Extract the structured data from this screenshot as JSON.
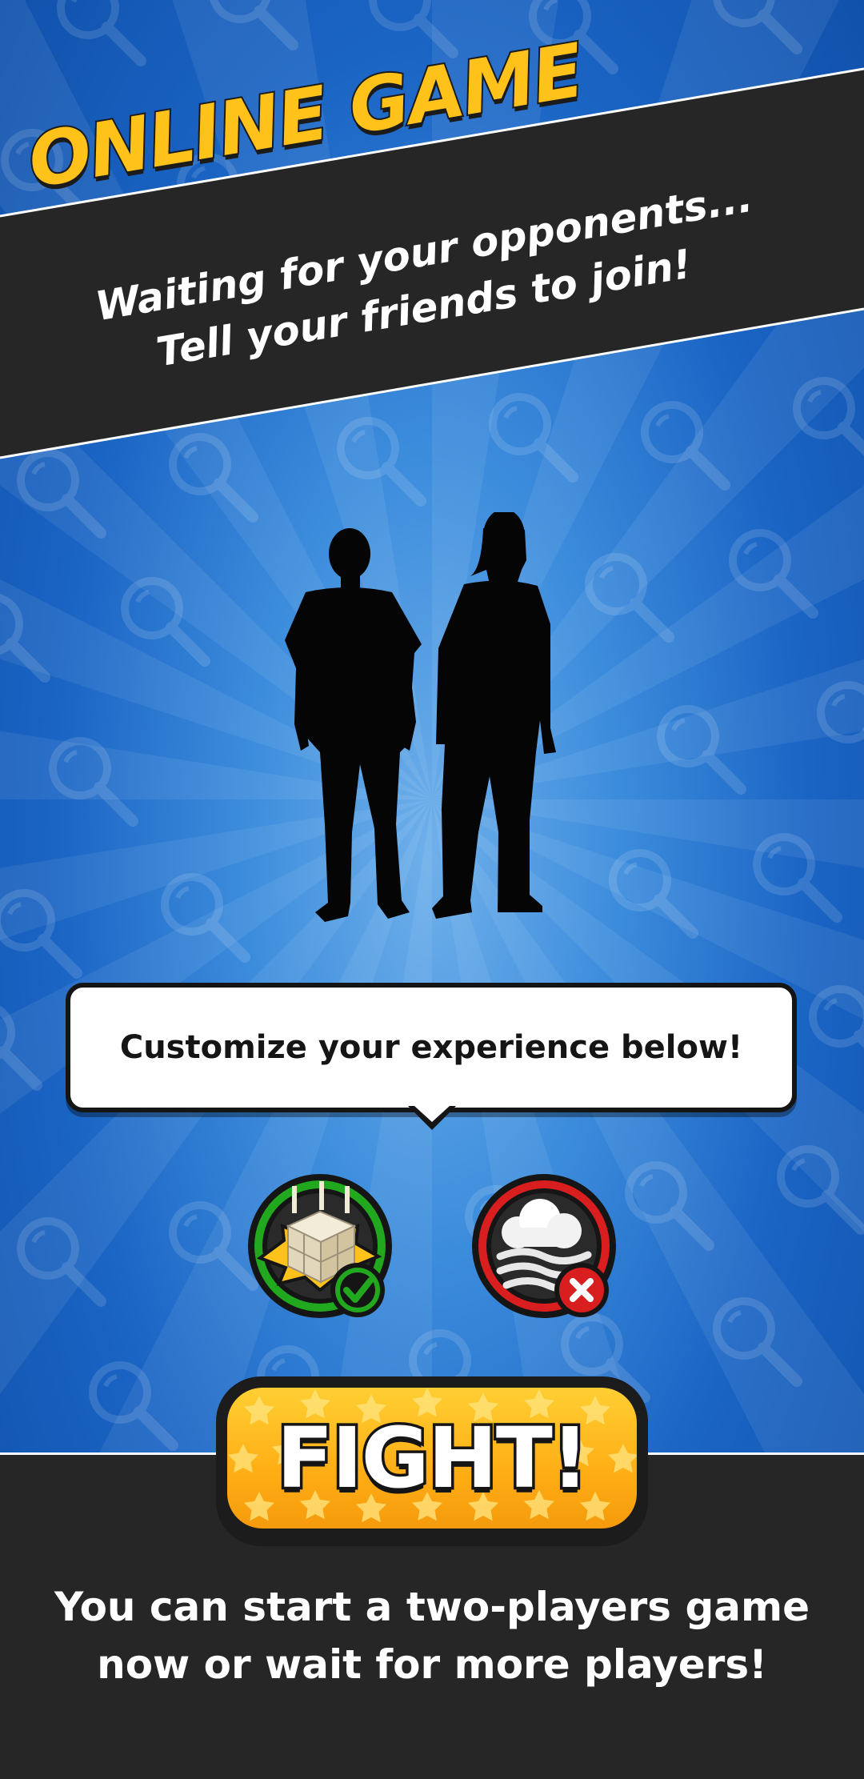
{
  "header": {
    "title": "ONLINE GAME",
    "subtitle_line1": "Waiting for your opponents...",
    "subtitle_line2": "Tell your friends to join!"
  },
  "bubble": {
    "text": "Customize your experience below!"
  },
  "options": [
    {
      "name": "crate-explosion-option",
      "icon": "crate-explosion-icon",
      "status": "enabled",
      "badge": "check-badge-icon",
      "ring_color": "#22a81e"
    },
    {
      "name": "cloud-wind-option",
      "icon": "cloud-wind-icon",
      "status": "disabled",
      "badge": "cross-badge-icon",
      "ring_color": "#d81e1e"
    }
  ],
  "fight_button": {
    "label": "FIGHT!"
  },
  "footer": {
    "line1": "You can start a two-players game",
    "line2": "now or wait for more players!"
  },
  "colors": {
    "accent": "#ffc21a",
    "banner": "#262626",
    "background": "#1e6fd0"
  }
}
